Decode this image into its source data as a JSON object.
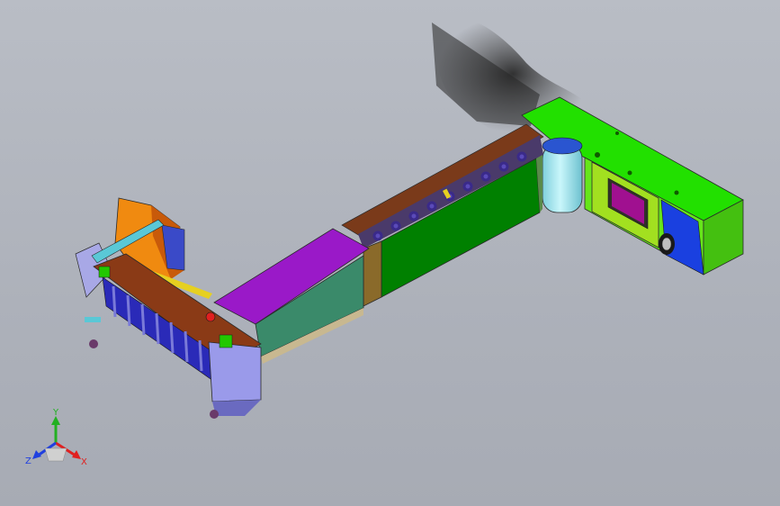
{
  "viewport": {
    "background": "#b1b5be",
    "model_colors": {
      "green_housing": "#22e000",
      "green_panel": "#008000",
      "teal_panel": "#3a8a6a",
      "purple_hood": "#9a19c8",
      "brown_plate": "#8a3a16",
      "orange_hopper": "#f08a10",
      "blue_lavender": "#9a9aea",
      "cyan_cylinder": "#9ae6ee",
      "lime_panel": "#a2e020",
      "magenta_window": "#a01090",
      "blue_motor": "#1a40e0"
    }
  },
  "triad": {
    "y_label": "Y",
    "x_label": "X",
    "z_label": "Z",
    "icon": "coordinate-triad-icon"
  }
}
